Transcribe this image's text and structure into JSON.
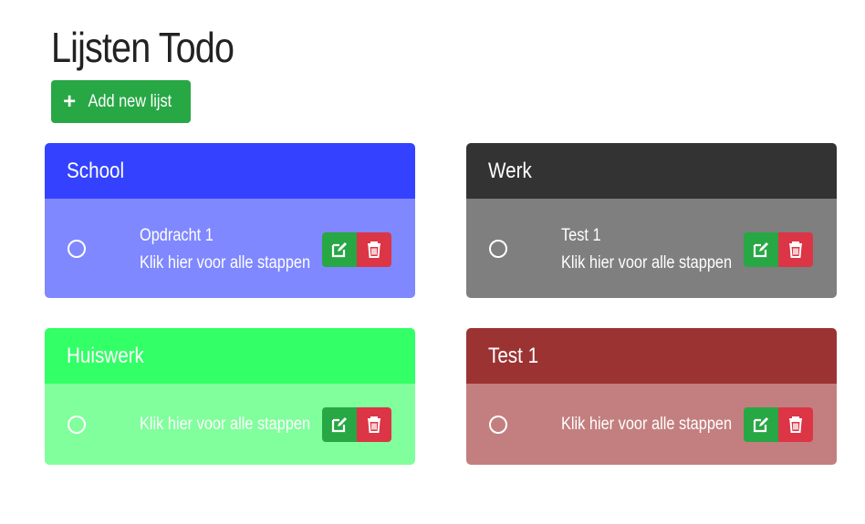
{
  "page": {
    "title": "Lijsten Todo",
    "add_button_label": "Add new lijst"
  },
  "colors": {
    "add_button": "#28a745",
    "edit_button": "#28a745",
    "delete_button": "#dc3545"
  },
  "lists": [
    {
      "name": "School",
      "header_color": "#3442ff",
      "body_color": "#7f88ff",
      "items": [
        {
          "title": "Opdracht 1",
          "link_text": "Klik hier voor alle stappen"
        }
      ]
    },
    {
      "name": "Werk",
      "header_color": "#333333",
      "body_color": "#7f7f7f",
      "items": [
        {
          "title": "Test 1",
          "link_text": "Klik hier voor alle stappen"
        }
      ]
    },
    {
      "name": "Huiswerk",
      "header_color": "#33ff66",
      "body_color": "#80ff9c",
      "items": [
        {
          "title": "",
          "link_text": "Klik hier voor alle stappen"
        }
      ]
    },
    {
      "name": "Test 1",
      "header_color": "#9c3333",
      "body_color": "#c37f7f",
      "items": [
        {
          "title": "",
          "link_text": "Klik hier voor alle stappen"
        }
      ]
    }
  ],
  "icons": {
    "add": "plus-icon",
    "edit": "edit-icon",
    "delete": "trash-icon",
    "item_status": "circle-icon"
  }
}
